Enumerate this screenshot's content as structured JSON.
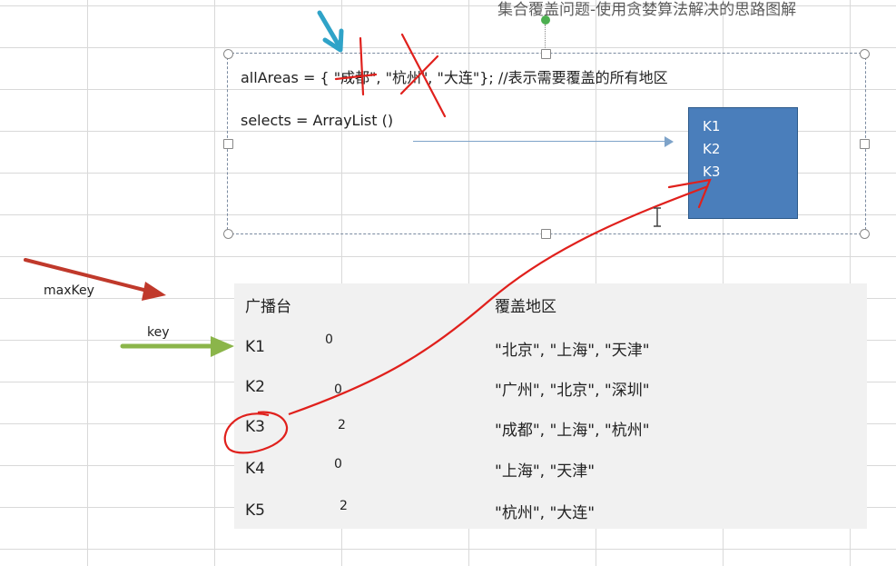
{
  "title": "集合覆盖问题-使用贪婪算法解决的思路图解",
  "code": {
    "all_areas": "allAreas = { \"成都\", \"杭州\", \"大连\"}; //表示需要覆盖的所有地区",
    "selects": "selects = ArrayList ()"
  },
  "selects_items": [
    "K1",
    "K2",
    "K3"
  ],
  "labels": {
    "max_key": "maxKey",
    "key": "key"
  },
  "table": {
    "headers": {
      "station": "广播台",
      "areas": "覆盖地区"
    },
    "rows": [
      {
        "station": "K1",
        "count": "0",
        "areas": "\"北京\", \"上海\", \"天津\""
      },
      {
        "station": "K2",
        "count": "0",
        "areas": "\"广州\", \"北京\", \"深圳\""
      },
      {
        "station": "K3",
        "count": "2",
        "areas": "\"成都\", \"上海\", \"杭州\""
      },
      {
        "station": "K4",
        "count": "0",
        "areas": "\"上海\", \"天津\""
      },
      {
        "station": "K5",
        "count": "2",
        "areas": "\"杭州\", \"大连\""
      }
    ]
  },
  "colors": {
    "selects_box": "#4a7ebb",
    "annotation_red": "#e0201c",
    "arrow_green": "#8bb54a",
    "arrow_red": "#c0392b",
    "arrow_teal": "#2fa3c8"
  }
}
